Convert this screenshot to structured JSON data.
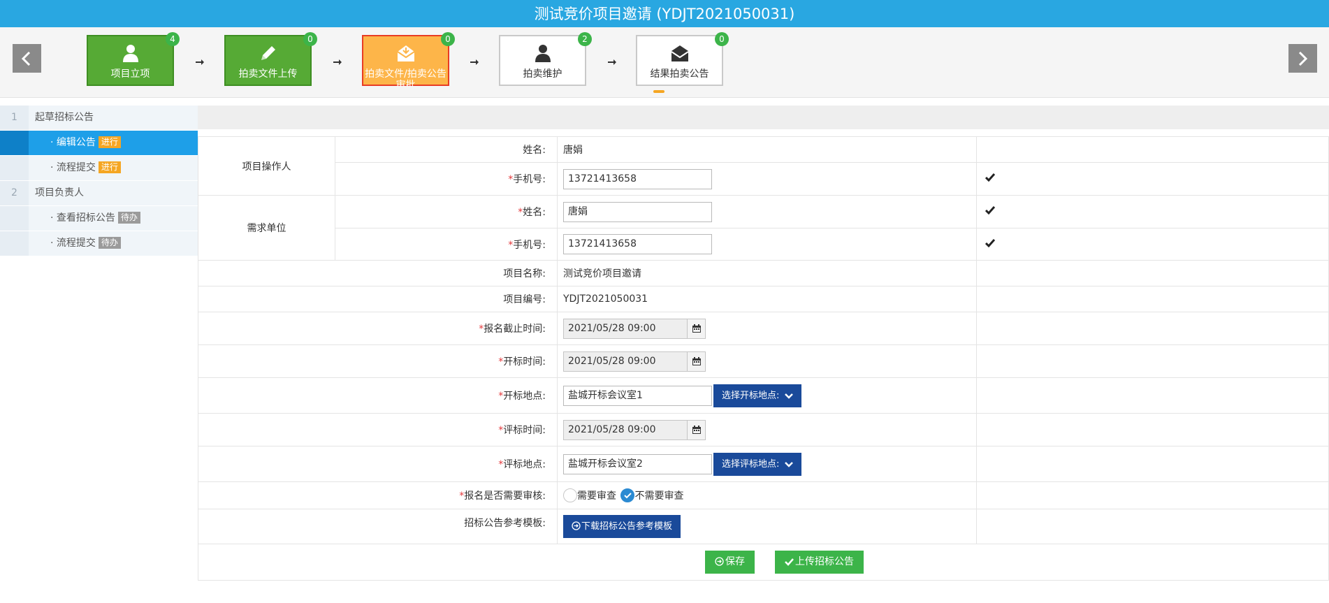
{
  "title": "测试竞价项目邀请 (YDJT2021050031)",
  "steps": [
    {
      "label": "项目立项",
      "badge": "4",
      "icon": "user-icon"
    },
    {
      "label": "拍卖文件上传",
      "badge": "0",
      "icon": "pencil-icon"
    },
    {
      "label": "拍卖文件/拍卖公告审批",
      "badge": "0",
      "icon": "envelope-open-icon"
    },
    {
      "label": "拍卖维护",
      "badge": "2",
      "icon": "user-icon"
    },
    {
      "label": "结果拍卖公告",
      "badge": "0",
      "icon": "envelope-icon"
    }
  ],
  "sidebar": {
    "items": [
      {
        "num": "1",
        "label": "起草招标公告",
        "tag": ""
      },
      {
        "num": "",
        "label": "· 编辑公告",
        "tag": "进行"
      },
      {
        "num": "",
        "label": "· 流程提交",
        "tag": "进行"
      },
      {
        "num": "2",
        "label": "项目负责人",
        "tag": ""
      },
      {
        "num": "",
        "label": "· 查看招标公告",
        "tag": "待办"
      },
      {
        "num": "",
        "label": "· 流程提交",
        "tag": "待办"
      }
    ]
  },
  "form": {
    "group_operator": "项目操作人",
    "group_demand": "需求单位",
    "name_label": "姓名:",
    "phone_label": "手机号:",
    "op_name": "唐娟",
    "op_phone": "13721413658",
    "demand_name": "唐娟",
    "demand_phone": "13721413658",
    "project_name_label": "项目名称:",
    "project_name": "测试竞价项目邀请",
    "project_no_label": "项目编号:",
    "project_no": "YDJT2021050031",
    "reg_deadline_label": "报名截止时间:",
    "reg_deadline": "2021/05/28 09:00",
    "open_time_label": "开标时间:",
    "open_time": "2021/05/28 09:00",
    "open_place_label": "开标地点:",
    "open_place": "盐城开标会议室1",
    "open_place_btn": "选择开标地点:",
    "eval_time_label": "评标时间:",
    "eval_time": "2021/05/28 09:00",
    "eval_place_label": "评标地点:",
    "eval_place": "盐城开标会议室2",
    "eval_place_btn": "选择评标地点:",
    "review_label": "报名是否需要审核:",
    "review_opt1": "需要审查",
    "review_opt2": "不需要审查",
    "review_selected": "不需要审查",
    "template_label": "招标公告参考模板:",
    "template_btn": "下载招标公告参考模板",
    "req_mark": "*"
  },
  "actions": {
    "save": "保存",
    "upload": "上传招标公告"
  },
  "colors": {
    "title_bg": "#29a7e1",
    "step_done": "#56aa35",
    "step_active": "#fdb549",
    "sidebar_selected": "#1e9fe8",
    "primary_button": "#1a4a9a",
    "success_button": "#3cb449"
  }
}
